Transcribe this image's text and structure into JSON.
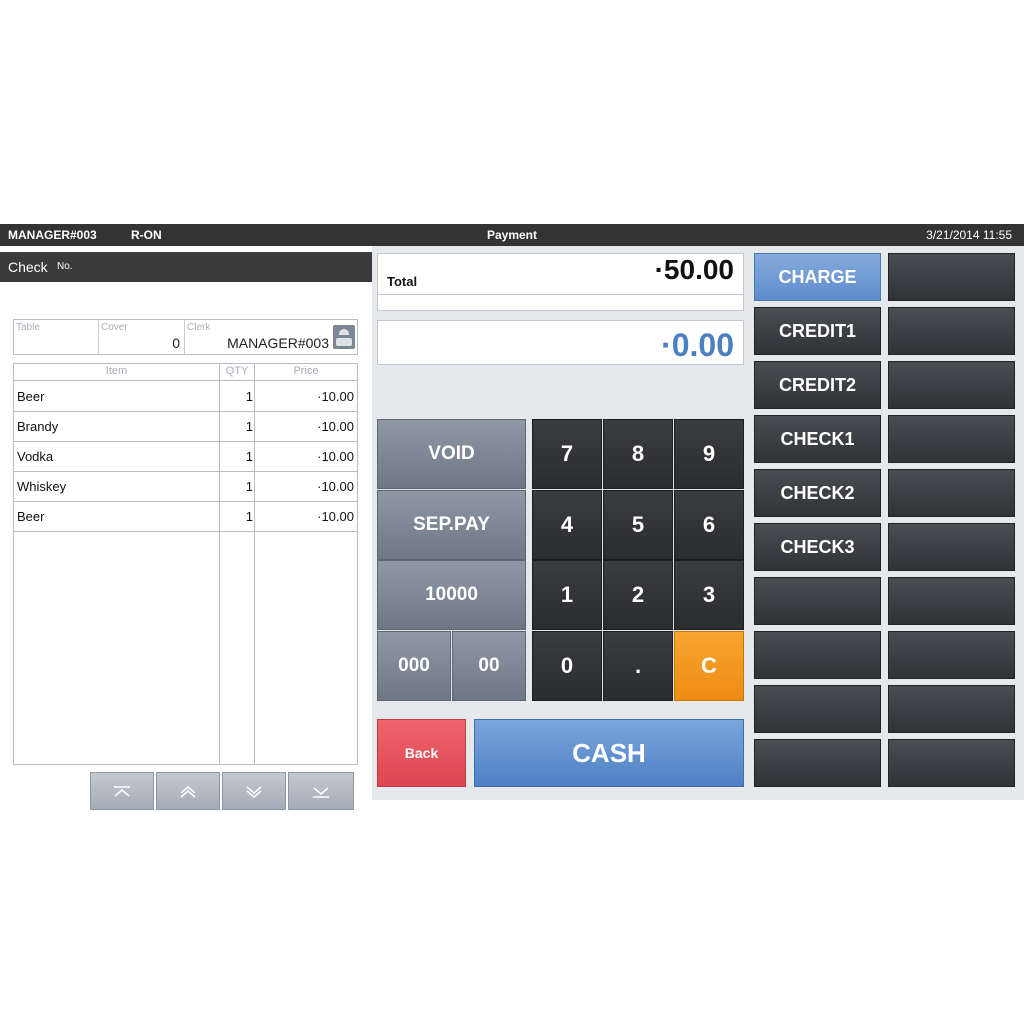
{
  "topbar": {
    "user": "MANAGER#003",
    "mode": "R-ON",
    "title": "Payment",
    "datetime": "3/21/2014 11:55"
  },
  "check": {
    "title": "Check",
    "no_label": "No.",
    "table_label": "Table",
    "table_value": "",
    "cover_label": "Cover",
    "cover_value": "0",
    "clerk_label": "Clerk",
    "clerk_value": "MANAGER#003",
    "columns": {
      "item": "Item",
      "qty": "QTY",
      "price": "Price"
    },
    "rows": [
      {
        "item": "Beer",
        "qty": "1",
        "price": "·10.00"
      },
      {
        "item": "Brandy",
        "qty": "1",
        "price": "·10.00"
      },
      {
        "item": "Vodka",
        "qty": "1",
        "price": "·10.00"
      },
      {
        "item": "Whiskey",
        "qty": "1",
        "price": "·10.00"
      },
      {
        "item": "Beer",
        "qty": "1",
        "price": "·10.00"
      }
    ],
    "scroll_icons": [
      "scroll-top-icon",
      "scroll-up-icon",
      "scroll-down-icon",
      "scroll-bottom-icon"
    ]
  },
  "payment": {
    "total_label": "Total",
    "total_value": "·50.00",
    "entered_value": "·0.00"
  },
  "keypad": {
    "void": "VOID",
    "seppay": "SEP.PAY",
    "k10000": "10000",
    "k000": "000",
    "k00": "00",
    "k7": "7",
    "k8": "8",
    "k9": "9",
    "k4": "4",
    "k5": "5",
    "k6": "6",
    "k1": "1",
    "k2": "2",
    "k3": "3",
    "k0": "0",
    "kdot": ".",
    "kc": "C",
    "back": "Back",
    "cash": "CASH"
  },
  "tenders": {
    "charge": "CHARGE",
    "credit1": "CREDIT1",
    "credit2": "CREDIT2",
    "check1": "CHECK1",
    "check2": "CHECK2",
    "check3": "CHECK3"
  },
  "colors": {
    "accent_blue": "#5e8ccd",
    "amount_blue": "#4a7fc1",
    "clear_orange": "#f29a20",
    "back_red": "#e5515a"
  }
}
